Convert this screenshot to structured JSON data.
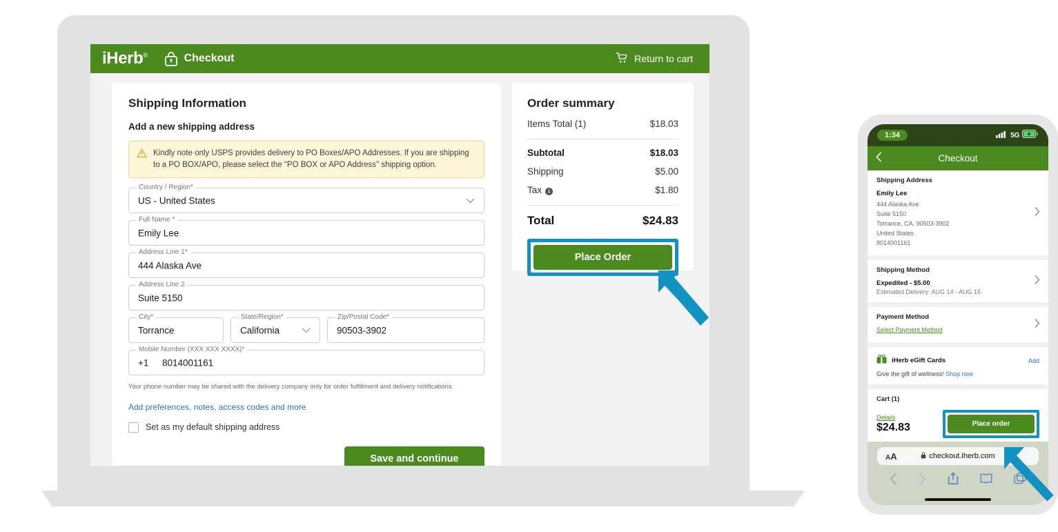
{
  "desktop": {
    "topbar": {
      "brand": "iHerb",
      "brand_reg": "®",
      "lock_icon": "lock-icon",
      "checkout_label": "Checkout",
      "cart_icon": "shopping-cart-icon",
      "return_to_cart": "Return to cart"
    },
    "form": {
      "heading": "Shipping Information",
      "subheading": "Add a new shipping address",
      "warning_icon": "warning-triangle-icon",
      "warning_text": "Kindly note only USPS provides delivery to PO Boxes/APO Addresses. If you are shipping to a PO BOX/APO, please select the \"PO BOX or APO Address\" shipping option.",
      "fields": {
        "country": {
          "label": "Country / Region*",
          "value": "US - United States",
          "icon": "chevron-down-icon"
        },
        "full_name": {
          "label": "Full Name *",
          "value": "Emily Lee"
        },
        "address1": {
          "label": "Address Line 1*",
          "value": "444 Alaska Ave"
        },
        "address2": {
          "label": "Address Line 2",
          "value": "Suite 5150"
        },
        "city": {
          "label": "City*",
          "value": "Torrance"
        },
        "state": {
          "label": "State/Region*",
          "value": "California",
          "icon": "chevron-down-icon"
        },
        "zip": {
          "label": "Zip/Postal Code*",
          "value": "90503-3902"
        },
        "mobile": {
          "label": "Mobile Number (XXX XXX XXXX)*",
          "prefix": "+1",
          "value": "8014001161"
        }
      },
      "phone_hint": "Your phone number may be shared with the delivery company only for order fulfillment and delivery notifications.",
      "preferences_link": "Add preferences, notes, access codes and more",
      "default_checkbox_label": "Set as my default shipping address",
      "save_button": "Save and continue"
    },
    "summary": {
      "heading": "Order summary",
      "lines": [
        {
          "label": "Items Total (1)",
          "value": "$18.03",
          "bold": false
        },
        {
          "label": "Subtotal",
          "value": "$18.03",
          "bold": true
        },
        {
          "label": "Shipping",
          "value": "$5.00",
          "bold": false
        },
        {
          "label": "Tax",
          "value": "$1.80",
          "bold": false,
          "info_icon": "info-icon"
        }
      ],
      "total_label": "Total",
      "total_value": "$24.83",
      "place_order_button": "Place Order"
    }
  },
  "phone": {
    "status": {
      "time": "1:34",
      "signal_icon": "signal-bars-icon",
      "network": "5G",
      "battery_icon": "battery-charging-icon"
    },
    "header": {
      "back_icon": "chevron-left-icon",
      "title": "Checkout"
    },
    "shipping_address": {
      "section_title": "Shipping Address",
      "name": "Emily Lee",
      "lines": [
        "444 Alaska Ave",
        "Suite 5150",
        "Torrance, CA, 90503-3902",
        "United States",
        "8014001161"
      ],
      "chevron": "chevron-right-icon"
    },
    "shipping_method": {
      "section_title": "Shipping Method",
      "option": "Expedited - $5.00",
      "estimate": "Estimated Delivery: AUG 14 - AUG 16",
      "chevron": "chevron-right-icon"
    },
    "payment_method": {
      "section_title": "Payment Method",
      "link": "Select Payment Method",
      "chevron": "chevron-right-icon"
    },
    "gift_cards": {
      "icon": "gift-card-icon",
      "title": "iHerb eGift Cards",
      "add_label": "Add",
      "subtitle_text": "Give the gift of wellness!",
      "subtitle_link": "Shop now"
    },
    "cart": {
      "section_title": "Cart (1)",
      "details_link": "Details",
      "price": "$24.83",
      "place_order_button": "Place order"
    },
    "safari": {
      "aa_label": "AA",
      "lock_icon": "lock-icon",
      "url": "checkout.iherb.com",
      "back_icon": "chevron-left-icon",
      "forward_icon": "chevron-right-icon",
      "share_icon": "share-icon",
      "bookmarks_icon": "book-icon",
      "tabs_icon": "tabs-icon"
    }
  },
  "annotation": {
    "highlight_color": "#1292c0",
    "brand_green": "#4a8a1e",
    "arrow_icon": "pointer-arrow-icon"
  }
}
